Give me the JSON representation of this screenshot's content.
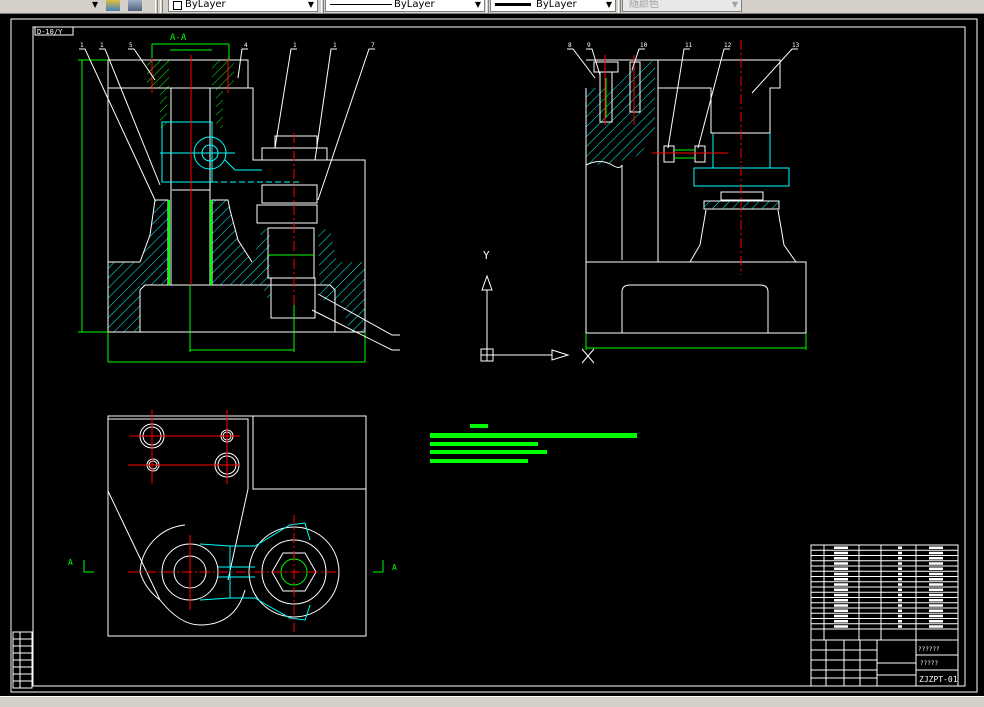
{
  "toolbar": {
    "color_combo": "ByLayer",
    "linetype_combo": "ByLayer",
    "lineweight_combo": "ByLayer",
    "plotstyle_combo": "随颜色",
    "icons": [
      "layer-states-icon",
      "layer-previous-icon"
    ]
  },
  "drawing": {
    "view_label": "D-10/Y",
    "section_label": "A-A",
    "section_mark": "A",
    "ucs_y": "Y",
    "left_view_callouts": [
      "1",
      "1",
      "5",
      "4",
      "1",
      "1",
      "7"
    ],
    "right_view_callouts": [
      "8",
      "9",
      "10",
      "11",
      "12",
      "13"
    ],
    "drawing_number": "ZJZPT-01",
    "title_line_1": "??????",
    "title_line_2": "?????",
    "colors": {
      "background": "#000000",
      "outline": "#ffffff",
      "centerline": "#ff0000",
      "dimension": "#00ff00",
      "hidden": "#00ffff"
    }
  }
}
